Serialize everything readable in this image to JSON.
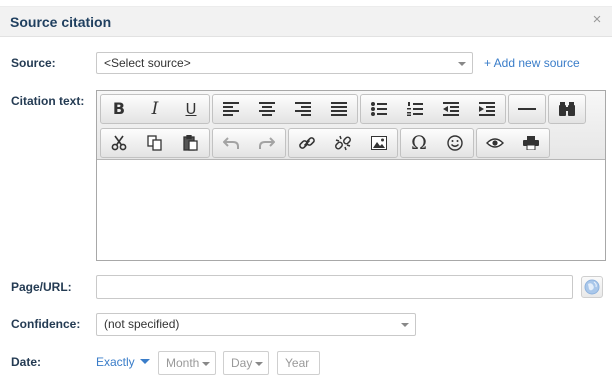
{
  "dialog": {
    "title": "Source citation",
    "close_glyph": "×"
  },
  "source": {
    "label": "Source:",
    "selected": "<Select source>",
    "add_link": "+ Add new source"
  },
  "citation": {
    "label": "Citation text:",
    "toolbar_row1": [
      "bold-icon",
      "italic-icon",
      "underline-icon",
      "align-left-icon",
      "align-center-icon",
      "align-right-icon",
      "align-justify-icon",
      "bulleted-list-icon",
      "numbered-list-icon",
      "outdent-icon",
      "indent-icon",
      "horizontal-rule-icon",
      "find-binoculars-icon"
    ],
    "toolbar_row2": [
      "cut-icon",
      "copy-icon",
      "paste-icon",
      "undo-icon",
      "redo-icon",
      "link-icon",
      "unlink-icon",
      "image-icon",
      "special-character-icon",
      "emoticon-icon",
      "preview-icon",
      "print-icon"
    ],
    "glyphs": {
      "bold": "B",
      "italic": "I",
      "underline": "U",
      "omega": "Ω"
    }
  },
  "page": {
    "label": "Page/URL:",
    "value": ""
  },
  "confidence": {
    "label": "Confidence:",
    "selected": "(not specified)"
  },
  "date": {
    "label": "Date:",
    "mode": "Exactly",
    "month": "Month",
    "day": "Day",
    "year": "Year"
  },
  "colors": {
    "title": "#1f3f5f",
    "label": "#243b53",
    "link": "#3a7dc9"
  }
}
